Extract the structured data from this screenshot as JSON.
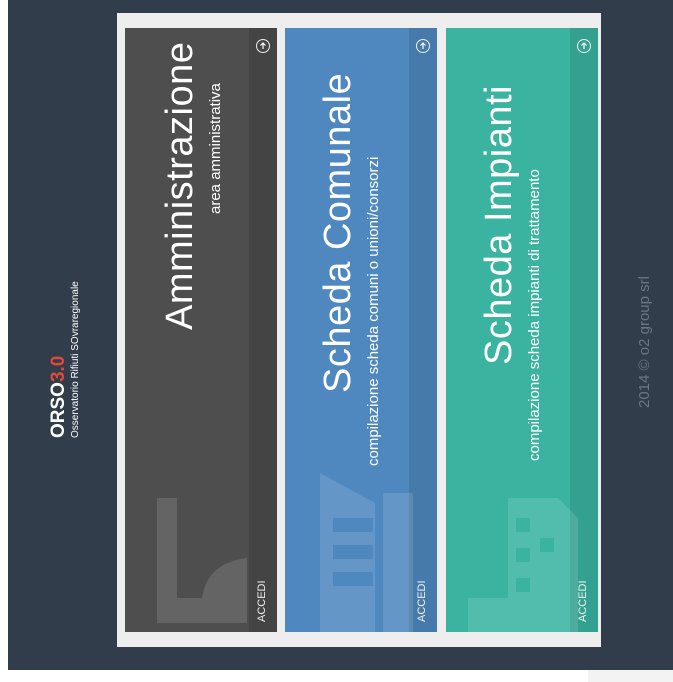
{
  "brand": {
    "name": "ORSO",
    "version": "3.0",
    "subtitle": "Osservatorio Rifiuti SOvraregionale"
  },
  "cards": [
    {
      "title": "Amministrazione",
      "subtitle": "area amministrativa",
      "action": "ACCEDI",
      "icon": "document-icon",
      "color": "#4e4e4e"
    },
    {
      "title": "Scheda Comunale",
      "subtitle": "compilazione scheda comuni o unioni/consorzi",
      "action": "ACCEDI",
      "icon": "town-hall-icon",
      "color": "#4e88bf"
    },
    {
      "title": "Scheda Impianti",
      "subtitle": "compilazione scheda impianti di trattamento",
      "action": "ACCEDI",
      "icon": "factory-icon",
      "color": "#3ab4a1"
    }
  ],
  "footer": {
    "copyright": "2014 © o2 group srl"
  },
  "colors": {
    "background": "#313d4b",
    "panel": "#eeeeef",
    "accent": "#e0493a"
  }
}
